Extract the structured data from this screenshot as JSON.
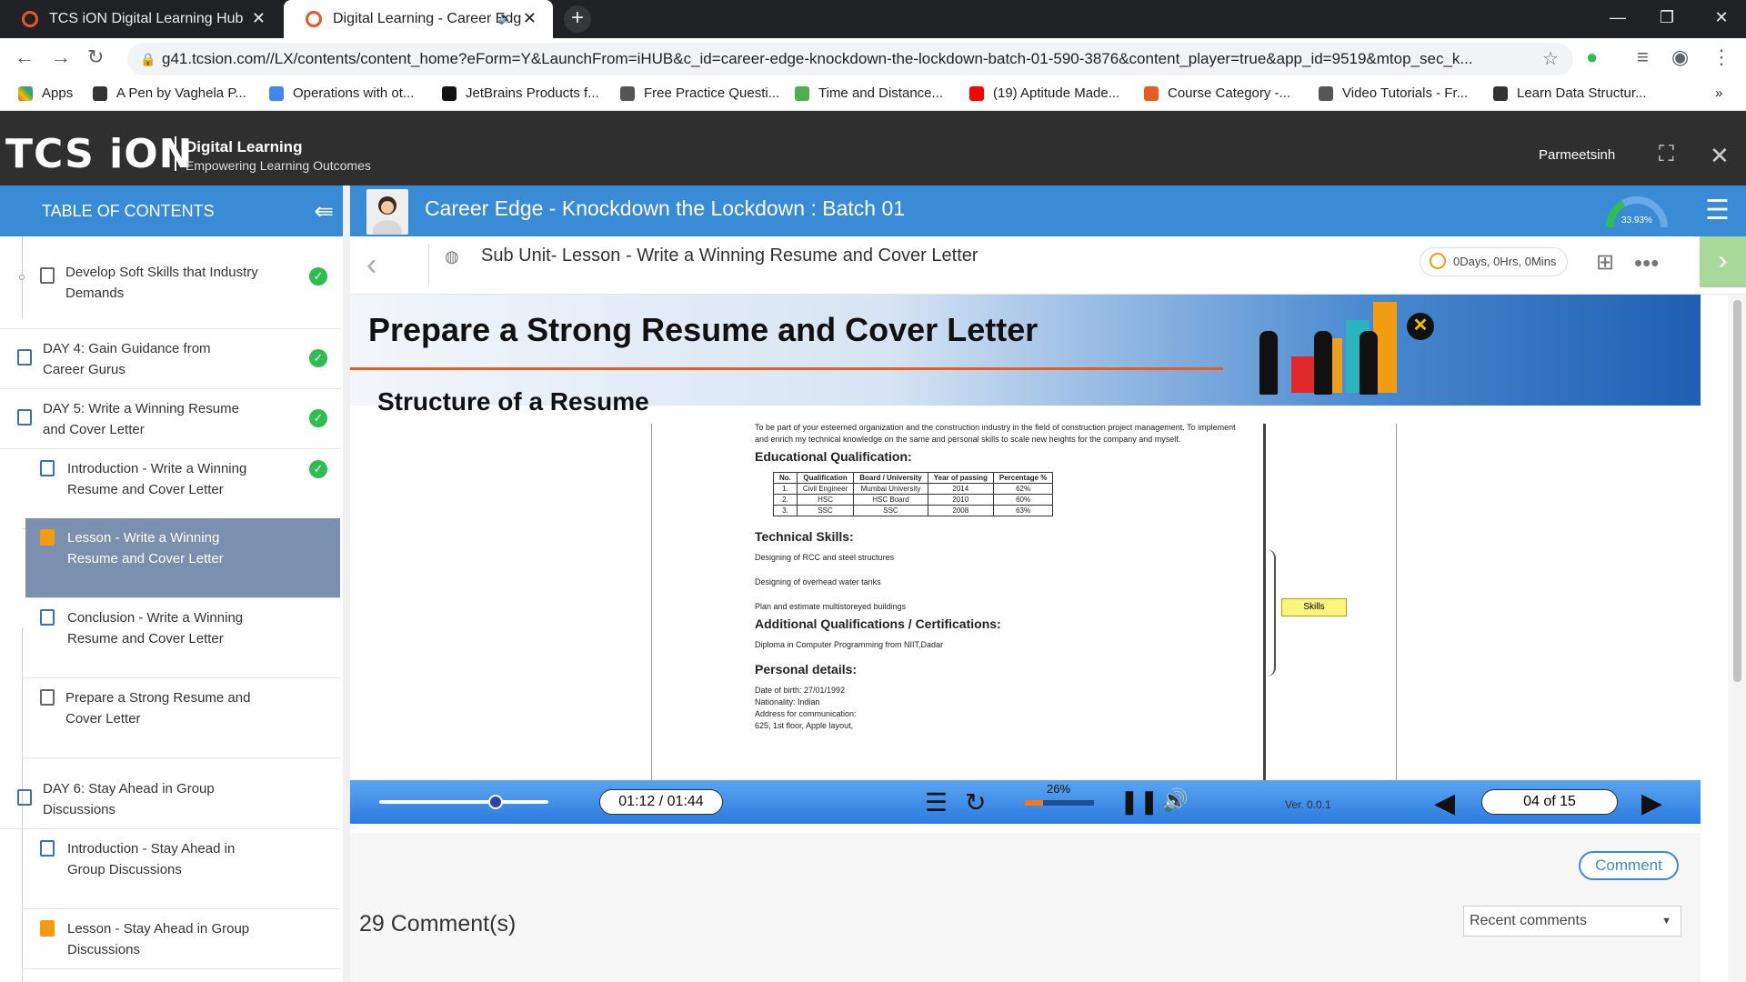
{
  "browser": {
    "tabs": [
      {
        "label": "TCS iON Digital Learning Hub"
      },
      {
        "label": "Digital Learning - Career Edg"
      }
    ],
    "url": "g41.tcsion.com//LX/contents/content_home?eForm=Y&LaunchFrom=iHUB&c_id=career-edge-knockdown-the-lockdown-batch-01-590-3876&content_player=true&app_id=9519&mtop_sec_k...",
    "bookmarks": [
      {
        "label": "Apps",
        "color": "#ea4335"
      },
      {
        "label": "A Pen by Vaghela P...",
        "color": "#333333"
      },
      {
        "label": "Operations with ot...",
        "color": "#4285f4"
      },
      {
        "label": "JetBrains Products f...",
        "color": "#111111"
      },
      {
        "label": "Free Practice Questi...",
        "color": "#555555"
      },
      {
        "label": "Time and Distance...",
        "color": "#4caf50"
      },
      {
        "label": "(19) Aptitude Made...",
        "color": "#ff0000"
      },
      {
        "label": "Course Category -...",
        "color": "#e95b1e"
      },
      {
        "label": "Video Tutorials - Fr...",
        "color": "#555555"
      },
      {
        "label": "Learn Data Structur...",
        "color": "#333333"
      }
    ]
  },
  "header": {
    "logo": "TCS iON",
    "brand_title": "Digital Learning",
    "brand_tagline": "Empowering Learning Outcomes",
    "username": "Parmeetsinh"
  },
  "toc": {
    "title": "TABLE OF CONTENTS",
    "items": [
      {
        "label": "Develop Soft Skills that Industry Demands",
        "done": true
      },
      {
        "label": "DAY 4: Gain Guidance from Career Gurus",
        "done": true
      },
      {
        "label": "DAY 5: Write a Winning Resume and Cover Letter",
        "done": true
      },
      {
        "label": "Introduction - Write a Winning Resume and Cover Letter",
        "done": true
      },
      {
        "label": "Lesson - Write a Winning Resume and Cover Letter",
        "done": false
      },
      {
        "label": "Conclusion - Write a Winning Resume and Cover Letter",
        "done": false
      },
      {
        "label": "Prepare a Strong Resume and Cover Letter",
        "done": false
      },
      {
        "label": "DAY 6: Stay Ahead in Group Discussions",
        "done": false
      },
      {
        "label": "Introduction - Stay Ahead in Group Discussions",
        "done": false
      },
      {
        "label": "Lesson - Stay Ahead in Group Discussions",
        "done": false
      }
    ]
  },
  "course": {
    "title": "Career Edge - Knockdown the Lockdown : Batch 01",
    "progress": "33.93%",
    "progress_value": 0.3393
  },
  "subunit": {
    "title": "Sub Unit- Lesson - Write a Winning Resume and Cover Letter",
    "timer": "0Days, 0Hrs, 0Mins"
  },
  "slide": {
    "title": "Prepare a Strong Resume and Cover Letter",
    "subtitle": "Structure of a Resume",
    "objective": "To be part of your esteemed organization and the construction industry in the field of construction project management. To implement and enrich my technical knowledge on the same and personal skills to scale new heights for the company and myself.",
    "edu_heading": "Educational Qualification:",
    "table_headers": [
      "No.",
      "Qualification",
      "Board / University",
      "Year of passing",
      "Percentage %"
    ],
    "table_rows": [
      [
        "1.",
        "Civil Engineer",
        "Mumbai University",
        "2014",
        "62%"
      ],
      [
        "2.",
        "HSC",
        "HSC Board",
        "2010",
        "60%"
      ],
      [
        "3.",
        "SSC",
        "SSC",
        "2008",
        "63%"
      ]
    ],
    "tech_heading": "Technical Skills:",
    "tech_skills": [
      "Designing of RCC and steel structures",
      "Designing of overhead water tanks",
      "Plan and estimate multistoreyed buildings"
    ],
    "addl_heading": "Additional Qualifications / Certifications:",
    "addl_item": "Diploma in Computer Programming from NIIT,Dadar",
    "personal_heading": "Personal details:",
    "personal_lines": [
      "Date of birth: 27/01/1992",
      "Nationality: Indian",
      "Address for communication:",
      "625, 1st floor, Apple layout,"
    ],
    "skills_tag": "Skills"
  },
  "player": {
    "time": "01:12 / 01:44",
    "seek_value": 0.69,
    "volume": "26%",
    "volume_value": 0.26,
    "version": "Ver. 0.0.1",
    "page": "04 of 15"
  },
  "comments": {
    "button": "Comment",
    "count_label": "29 Comment(s)",
    "sort": "Recent comments"
  }
}
